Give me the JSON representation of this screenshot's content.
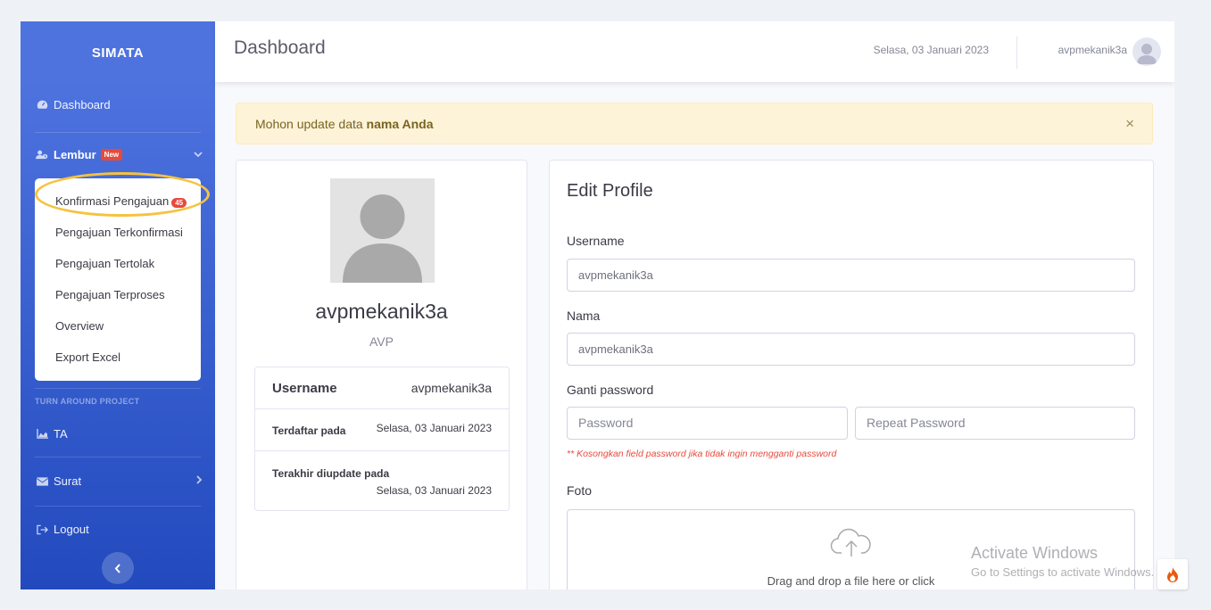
{
  "app": {
    "brand": "SIMATA"
  },
  "sidebar": {
    "dashboard": "Dashboard",
    "lembur": {
      "label": "Lembur",
      "badge": "New"
    },
    "lembur_items": [
      {
        "label": "Konfirmasi Pengajuan",
        "badge": "45"
      },
      {
        "label": "Pengajuan Terkonfirmasi"
      },
      {
        "label": "Pengajuan Tertolak"
      },
      {
        "label": "Pengajuan Terproses"
      },
      {
        "label": "Overview"
      },
      {
        "label": "Export Excel"
      }
    ],
    "section_heading": "TURN AROUND PROJECT",
    "ta": "TA",
    "surat": "Surat",
    "logout": "Logout"
  },
  "topbar": {
    "title": "Dashboard",
    "date": "Selasa, 03 Januari 2023",
    "username": "avpmekanik3a"
  },
  "alert": {
    "prefix": "Mohon update data ",
    "bold": "nama Anda",
    "close": "×"
  },
  "profile": {
    "name": "avpmekanik3a",
    "role": "AVP",
    "rows": [
      {
        "label": "Username",
        "value": "avpmekanik3a"
      },
      {
        "label": "Terdaftar pada",
        "value": "Selasa, 03 Januari 2023"
      },
      {
        "label": "Terakhir diupdate pada",
        "value": "Selasa, 03 Januari 2023"
      }
    ]
  },
  "edit": {
    "title": "Edit Profile",
    "username_label": "Username",
    "username_value": "avpmekanik3a",
    "nama_label": "Nama",
    "nama_value": "avpmekanik3a",
    "password_label": "Ganti password",
    "password_placeholder": "Password",
    "repeat_placeholder": "Repeat Password",
    "hint": "** Kosongkan field password jika tidak ingin mengganti password",
    "foto_label": "Foto",
    "dropzone_text": "Drag and drop a file here or click"
  },
  "watermark": {
    "title": "Activate Windows",
    "sub": "Go to Settings to activate Windows."
  },
  "colors": {
    "sidebar": "#4e73df",
    "badge": "#e74a3b",
    "highlight": "#f6c23e",
    "alert_bg": "#fdf3d8"
  }
}
